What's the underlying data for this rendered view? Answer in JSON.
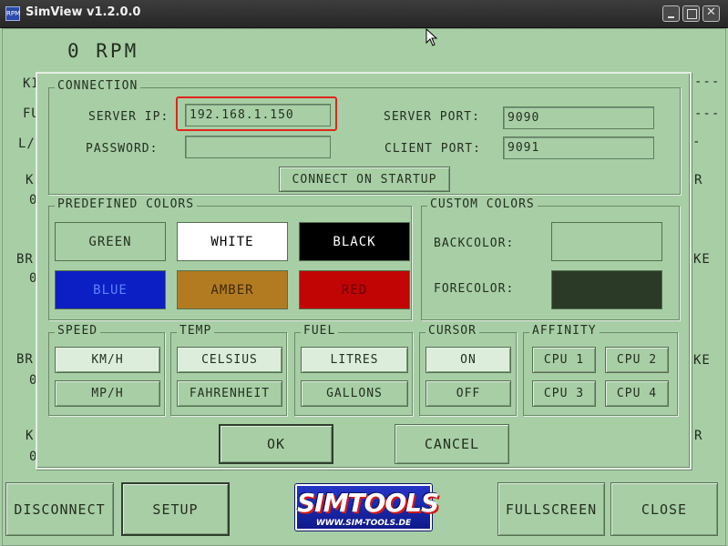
{
  "window": {
    "title": "SimView v1.2.0.0",
    "icon_label": "RPM",
    "close_glyph": "✕"
  },
  "dashboard": {
    "rpm": "0 RPM",
    "partial_labels": {
      "left": [
        "KI",
        "FU",
        "L/",
        "K",
        "0",
        "BR",
        "0",
        "BR",
        "0",
        "K",
        "0"
      ],
      "right": [
        "---",
        "---",
        "-",
        "R",
        "KE",
        "KE",
        "R"
      ]
    }
  },
  "dialog": {
    "connection": {
      "title": "CONNECTION",
      "server_ip_label": "SERVER IP:",
      "server_ip_value": "192.168.1.150",
      "password_label": "PASSWORD:",
      "password_value": "",
      "server_port_label": "SERVER PORT:",
      "server_port_value": "9090",
      "client_port_label": "CLIENT PORT:",
      "client_port_value": "9091",
      "connect_on_startup": "CONNECT ON STARTUP"
    },
    "predefined_colors": {
      "title": "PREDEFINED COLORS",
      "swatches": [
        {
          "label": "GREEN",
          "bg": "#a8cea6",
          "fg": "#24301f"
        },
        {
          "label": "WHITE",
          "bg": "#ffffff",
          "fg": "#000000"
        },
        {
          "label": "BLACK",
          "bg": "#000000",
          "fg": "#ffffff"
        },
        {
          "label": "BLUE",
          "bg": "#0b1fc4",
          "fg": "#5f82ff"
        },
        {
          "label": "AMBER",
          "bg": "#b27b22",
          "fg": "#3d2a08"
        },
        {
          "label": "RED",
          "bg": "#c10404",
          "fg": "#6b0000"
        }
      ]
    },
    "custom_colors": {
      "title": "CUSTOM COLORS",
      "backcolor_label": "BACKCOLOR:",
      "backcolor": "#a8cea6",
      "forecolor_label": "FORECOLOR:",
      "forecolor": "#2a3a27"
    },
    "speed": {
      "title": "SPEED",
      "options": [
        "KM/H",
        "MP/H"
      ]
    },
    "temp": {
      "title": "TEMP",
      "options": [
        "CELSIUS",
        "FAHRENHEIT"
      ]
    },
    "fuel": {
      "title": "FUEL",
      "options": [
        "LITRES",
        "GALLONS"
      ]
    },
    "cursor": {
      "title": "CURSOR",
      "options": [
        "ON",
        "OFF"
      ]
    },
    "affinity": {
      "title": "AFFINITY",
      "options": [
        "CPU 1",
        "CPU 2",
        "CPU 3",
        "CPU 4"
      ]
    },
    "ok": "OK",
    "cancel": "CANCEL"
  },
  "bottom_bar": {
    "disconnect": "DISCONNECT",
    "setup": "SETUP",
    "logo_main": "SIMTOOLS",
    "logo_sub": "WWW.SIM-TOOLS.DE",
    "fullscreen": "FULLSCREEN",
    "close": "CLOSE"
  }
}
